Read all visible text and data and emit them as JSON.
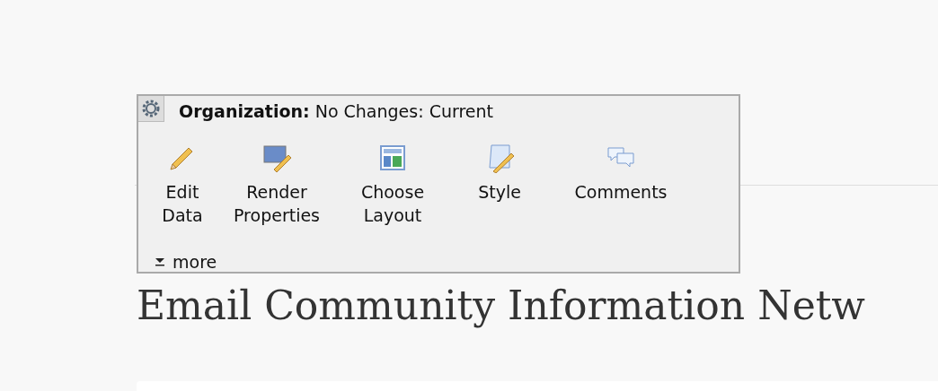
{
  "page": {
    "second_heading": "Email Community Information Netw"
  },
  "edit_panel": {
    "label": "Organization:",
    "status": "No Changes: Current",
    "actions": [
      {
        "kind": "pencil",
        "label": "Edit\nData"
      },
      {
        "kind": "render",
        "label": "Render\nProperties"
      },
      {
        "kind": "layout",
        "label": "Choose\nLayout"
      },
      {
        "kind": "style",
        "label": "Style"
      },
      {
        "kind": "comments",
        "label": "Comments"
      }
    ],
    "more": "more"
  }
}
